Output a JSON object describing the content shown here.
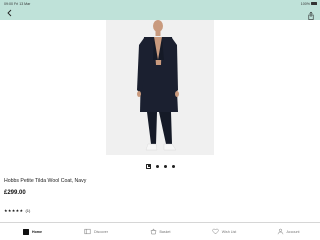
{
  "status_bar": {
    "time": "09:00",
    "date": "Fri 13 Mar",
    "battery_pct": "100%"
  },
  "product": {
    "name": "Hobbs Petite Tilda Wool Coat, Navy",
    "price": "£299.00",
    "rating_stars": "★★★★★",
    "rating_value": 5,
    "rating_count": "(1)",
    "image_pages": 4,
    "current_image_page": 1
  },
  "tab_bar": {
    "items": [
      {
        "label": "Home",
        "icon": "home-icon",
        "active": true
      },
      {
        "label": "Discover",
        "icon": "discover-icon",
        "active": false
      },
      {
        "label": "Basket",
        "icon": "basket-icon",
        "active": false
      },
      {
        "label": "Wish List",
        "icon": "heart-icon",
        "active": false
      },
      {
        "label": "Account",
        "icon": "account-icon",
        "active": false
      }
    ]
  },
  "colors": {
    "header": "#bfe2d9",
    "text": "#111111",
    "coat": "#1b2030"
  }
}
